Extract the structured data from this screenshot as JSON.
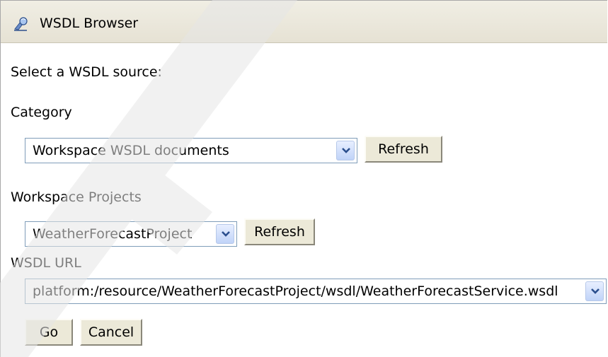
{
  "window": {
    "title": "WSDL Browser",
    "icon": "wsdl-browser-icon"
  },
  "form": {
    "heading": "Select a WSDL source:",
    "category": {
      "label": "Category",
      "selected": "Workspace WSDL documents",
      "refresh_label": "Refresh"
    },
    "projects": {
      "label": "Workspace Projects",
      "selected": "WeatherForecastProject",
      "refresh_label": "Refresh"
    },
    "wsdl_url": {
      "label": "WSDL URL",
      "selected": "platform:/resource/WeatherForecastProject/wsdl/WeatherForecastService.wsdl"
    },
    "buttons": {
      "go_label": "Go",
      "cancel_label": "Cancel"
    }
  },
  "colors": {
    "title_bar": "#ece9d8",
    "combo_border": "#7f9db9",
    "combo_arrow": "#c0d3f8",
    "button_face": "#ece9d8"
  }
}
